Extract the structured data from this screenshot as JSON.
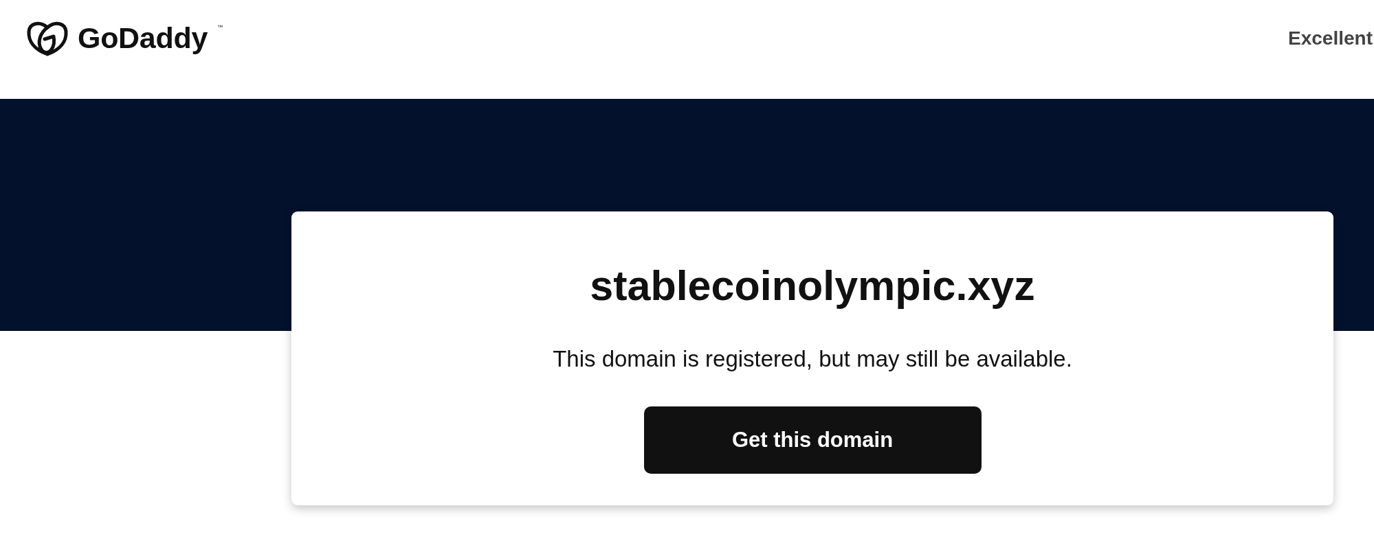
{
  "header": {
    "logo": {
      "wordmark": "GoDaddy",
      "trademark": "™"
    },
    "rating_label": "Excellent"
  },
  "domain_card": {
    "domain": "stablecoinolympic.xyz",
    "message": "This domain is registered, but may still be available.",
    "button": "Get this domain"
  }
}
